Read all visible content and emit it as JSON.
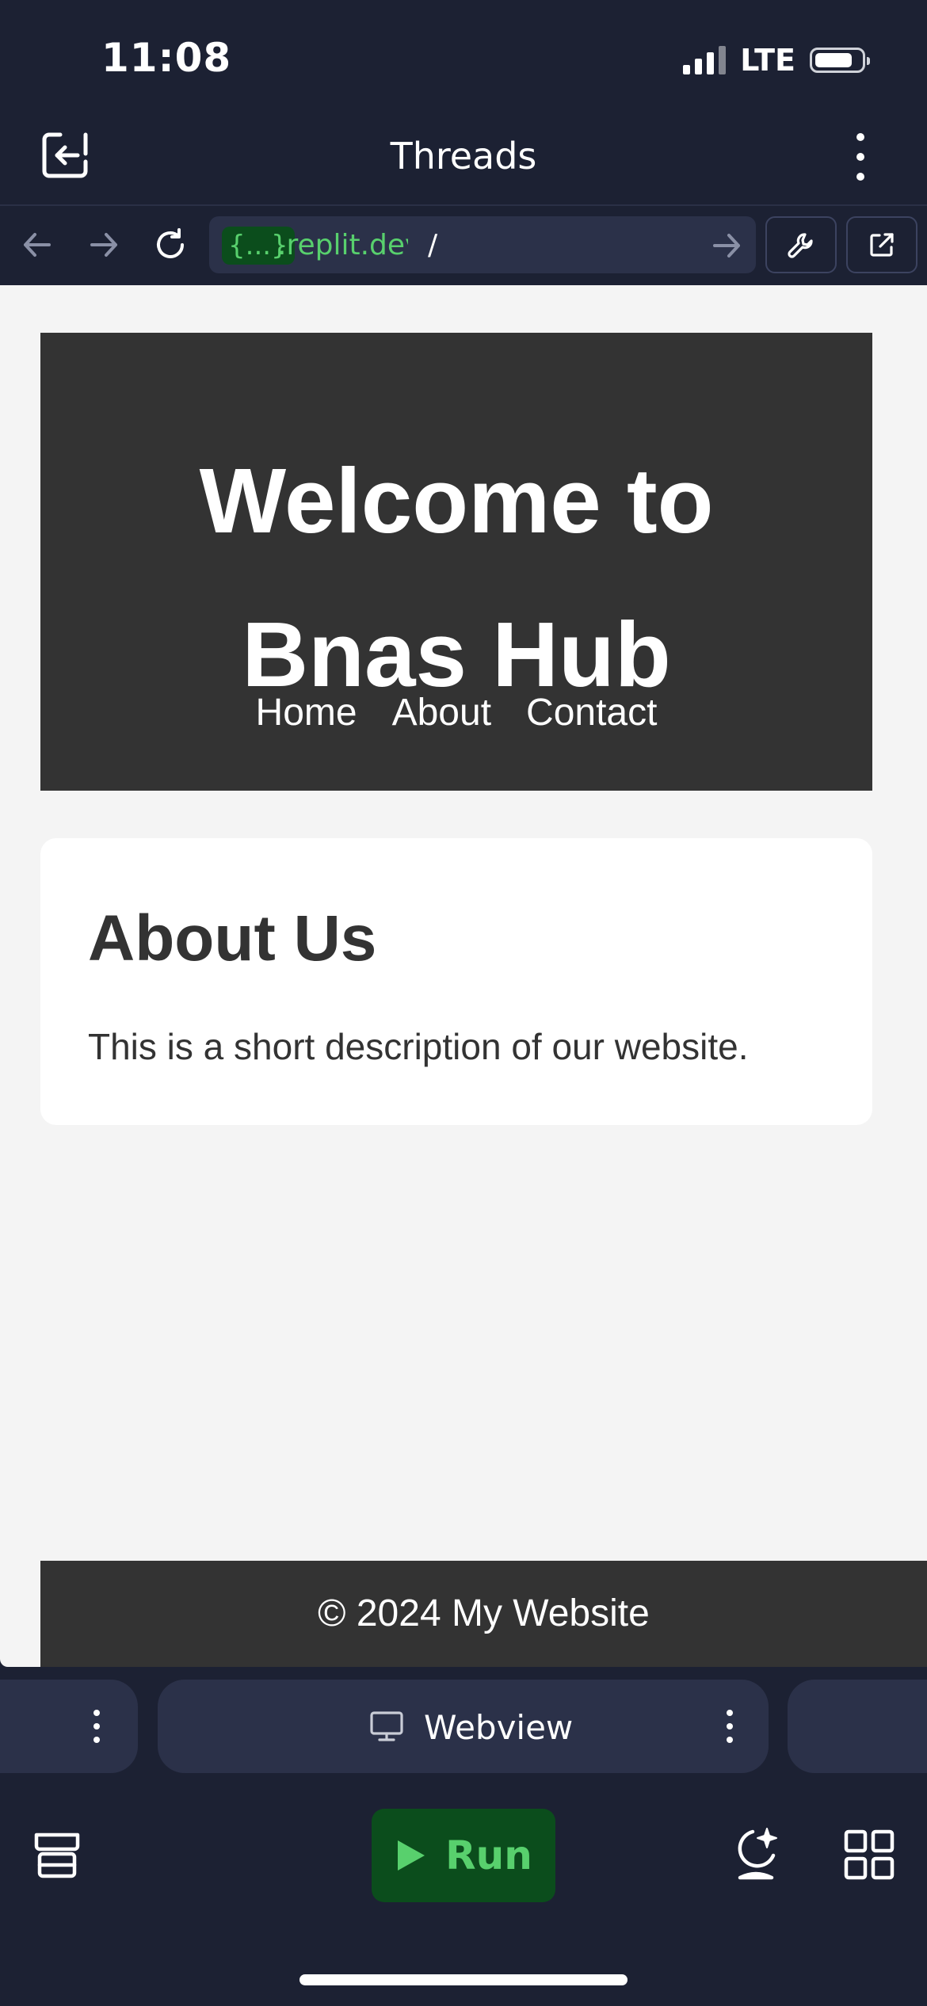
{
  "status_bar": {
    "time": "11:08",
    "network": "LTE"
  },
  "header": {
    "title": "Threads"
  },
  "browser": {
    "url_chip": "{...}",
    "url_domain": ".replit.dev",
    "url_path": "/"
  },
  "page": {
    "hero_title_line1": "Welcome to",
    "hero_title_line2": "Bnas Hub",
    "nav": [
      "Home",
      "About",
      "Contact"
    ],
    "section_title": "About Us",
    "section_text": "This is a short description of our website.",
    "footer": "© 2024 My Website"
  },
  "tabs": {
    "webview_label": "Webview"
  },
  "toolbar": {
    "run_label": "Run"
  },
  "colors": {
    "accent_green": "#58d06d",
    "run_bg": "#0b4d1c",
    "app_bg": "#1c2133",
    "site_dark": "#333333"
  },
  "icons": [
    "exit-icon",
    "more-vertical-icon",
    "back-arrow-icon",
    "forward-arrow-icon",
    "reload-icon",
    "go-arrow-icon",
    "wrench-icon",
    "external-link-icon",
    "monitor-icon",
    "play-icon",
    "layers-icon",
    "ai-assistant-icon",
    "grid-icon"
  ]
}
